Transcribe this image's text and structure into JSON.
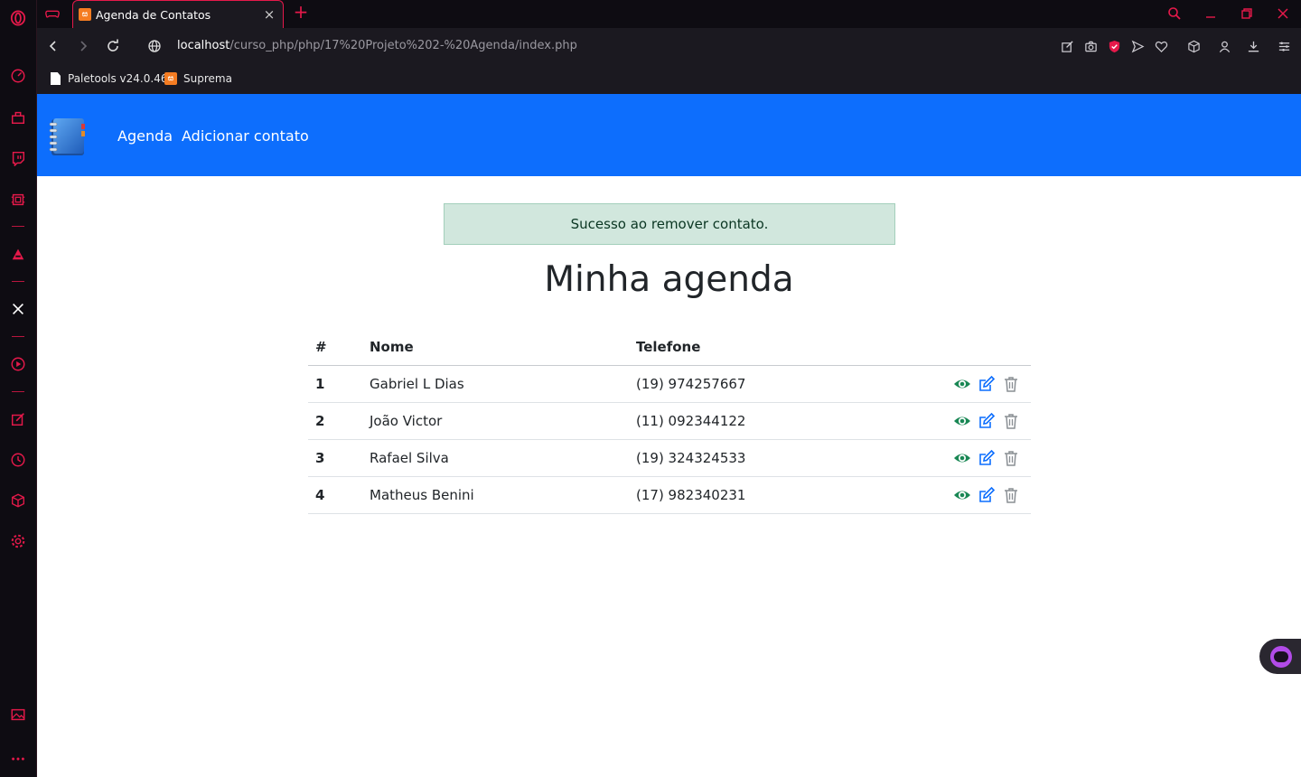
{
  "browser": {
    "tab_title": "Agenda de Contatos",
    "tab_favicon": "xampp",
    "url_host": "localhost",
    "url_path": "/curso_php/php/17%20Projeto%202-%20Agenda/index.php",
    "accent_color": "#e5194a"
  },
  "bookmarks": [
    {
      "label": "Paletools v24.0.46",
      "icon": "document-icon"
    },
    {
      "label": "Suprema",
      "icon": "xampp-icon"
    }
  ],
  "navbar": {
    "logo": "address-book-logo",
    "links": [
      "Agenda",
      "Adicionar contato"
    ],
    "color": "#0d6efd"
  },
  "alert": {
    "message": "Sucesso ao remover contato."
  },
  "page": {
    "title": "Minha agenda"
  },
  "table": {
    "headers": [
      "#",
      "Nome",
      "Telefone"
    ],
    "rows": [
      {
        "id": "1",
        "name": "Gabriel L Dias",
        "phone": "(19) 974257667"
      },
      {
        "id": "2",
        "name": "João Victor",
        "phone": "(11) 092344122"
      },
      {
        "id": "3",
        "name": "Rafael Silva",
        "phone": "(19) 324324533"
      },
      {
        "id": "4",
        "name": "Matheus Benini",
        "phone": "(17) 982340231"
      }
    ],
    "action_icons": [
      "eye-icon",
      "edit-icon",
      "trash-icon"
    ]
  }
}
